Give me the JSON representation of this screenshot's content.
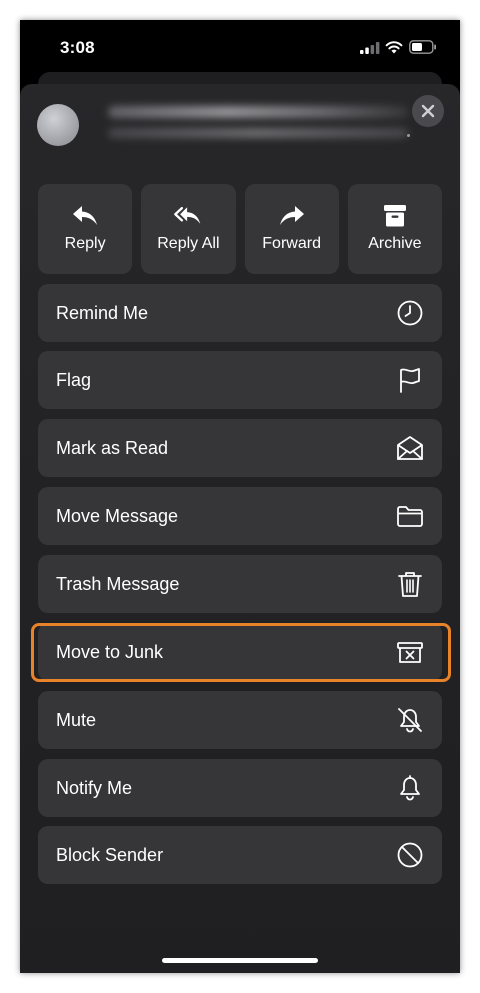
{
  "status_bar": {
    "time": "3:08"
  },
  "actions": [
    {
      "label": "Reply",
      "icon": "reply-icon"
    },
    {
      "label": "Reply All",
      "icon": "reply-all-icon"
    },
    {
      "label": "Forward",
      "icon": "forward-icon"
    },
    {
      "label": "Archive",
      "icon": "archive-icon"
    }
  ],
  "menu": [
    {
      "label": "Remind Me",
      "icon": "clock-icon"
    },
    {
      "label": "Flag",
      "icon": "flag-icon"
    },
    {
      "label": "Mark as Read",
      "icon": "envelope-open-icon"
    },
    {
      "label": "Move Message",
      "icon": "folder-icon"
    },
    {
      "label": "Trash Message",
      "icon": "trash-icon"
    },
    {
      "label": "Move to Junk",
      "icon": "junk-icon",
      "highlighted": true
    },
    {
      "label": "Mute",
      "icon": "bell-slash-icon"
    },
    {
      "label": "Notify Me",
      "icon": "bell-icon"
    },
    {
      "label": "Block Sender",
      "icon": "block-icon"
    }
  ],
  "colors": {
    "highlight": "#e8832a",
    "row_bg": "#363638",
    "sheet_bg": "#232325"
  }
}
